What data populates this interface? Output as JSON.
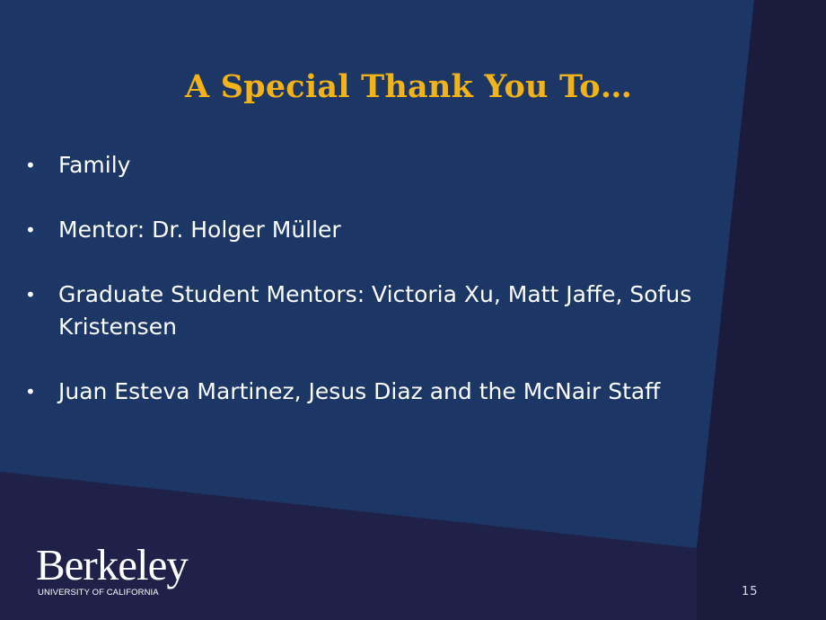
{
  "slide": {
    "title": "A Special Thank You To…",
    "bullet_marker": "•",
    "bullets": [
      "Family",
      "Mentor: Dr. Holger Müller",
      "Graduate Student Mentors: Victoria Xu, Matt Jaffe, Sofus Kristensen",
      "Juan Esteva Martinez, Jesus Diaz and the McNair Staff"
    ],
    "page_number": "15"
  },
  "logo": {
    "wordmark": "Berkeley",
    "subtitle": "UNIVERSITY OF CALIFORNIA"
  },
  "colors": {
    "panel_blue": "#1c3765",
    "background_dark": "#1f2148",
    "title_gold": "#f2b319",
    "text_white": "#ffffff"
  }
}
